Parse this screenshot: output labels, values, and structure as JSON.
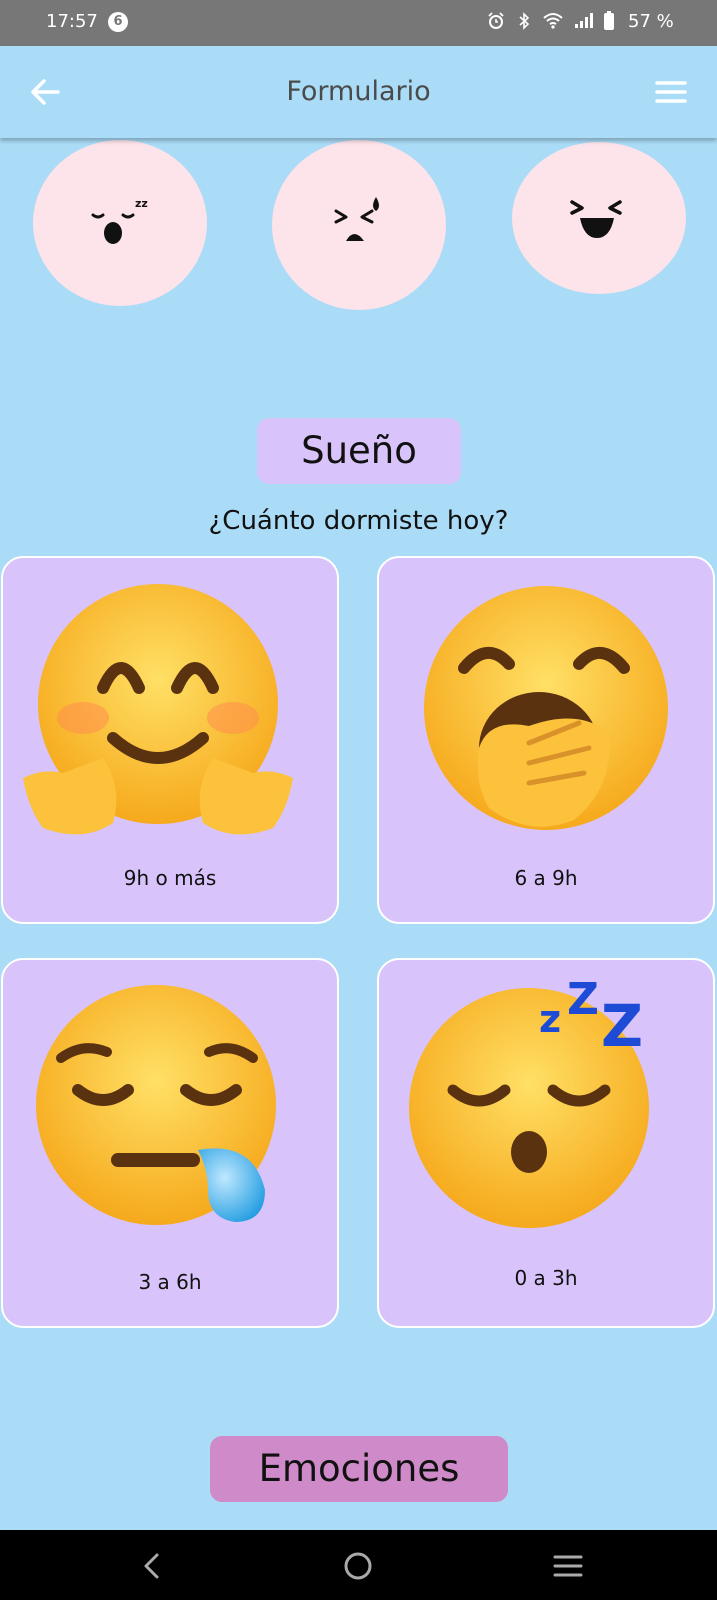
{
  "status_bar": {
    "time": "17:57",
    "notification_count": "6",
    "battery_percent": "57 %",
    "icons": [
      "alarm-icon",
      "bluetooth-icon",
      "wifi-icon",
      "signal-icon",
      "battery-icon"
    ]
  },
  "app_bar": {
    "title": "Formulario",
    "back_icon": "arrow-left-icon",
    "menu_icon": "hamburger-menu-icon"
  },
  "mood_options": [
    {
      "icon": "sleepy-face-icon"
    },
    {
      "icon": "tired-face-icon"
    },
    {
      "icon": "laughing-face-icon"
    }
  ],
  "sleep_section": {
    "title": "Sueño",
    "question": "¿Cuánto dormiste hoy?",
    "options": [
      {
        "label": "9h o más",
        "icon": "hugging-face-emoji"
      },
      {
        "label": "6 a 9h",
        "icon": "yawning-face-emoji"
      },
      {
        "label": "3 a 6h",
        "icon": "sleepy-face-emoji"
      },
      {
        "label": "0 a 3h",
        "icon": "sleeping-face-emoji"
      }
    ]
  },
  "emotions_section": {
    "title": "Emociones"
  },
  "colors": {
    "background": "#abdcf7",
    "card": "#d9c3fb",
    "sleep_pill": "#d9c3fb",
    "emotions_pill": "#cf8ac9",
    "mood_circle": "#fde3ea"
  },
  "nav_bar": {
    "icons": [
      "back-nav-icon",
      "home-nav-icon",
      "recents-nav-icon"
    ]
  }
}
